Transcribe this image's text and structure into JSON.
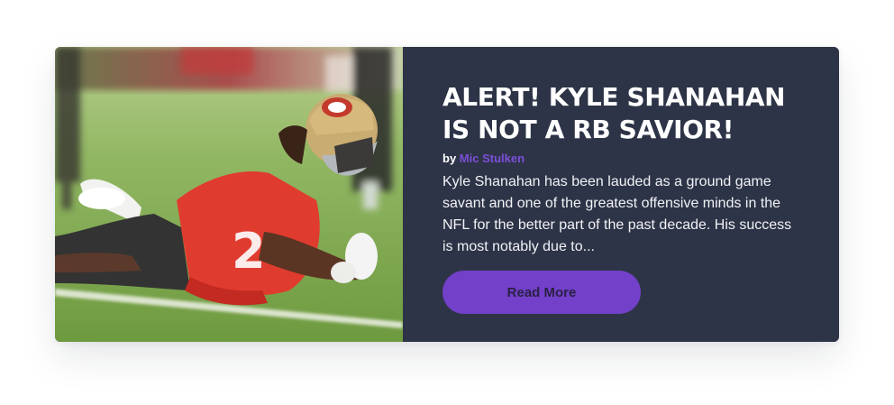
{
  "post": {
    "title": "ALERT! KYLE SHANAHAN IS NOT A RB SAVIOR!",
    "by_label": "by",
    "author": "Mic Stulken",
    "excerpt": "Kyle Shanahan has been lauded as a ground game savant and one of the greatest offensive minds in the NFL for the better part of the past decade. His success is most notably due to...",
    "read_more_label": "Read More"
  },
  "colors": {
    "card_background": "#2e3447",
    "accent": "#7240c9",
    "author_link": "#7b4fd8"
  },
  "image": {
    "description_icon": "football-player-photo"
  }
}
